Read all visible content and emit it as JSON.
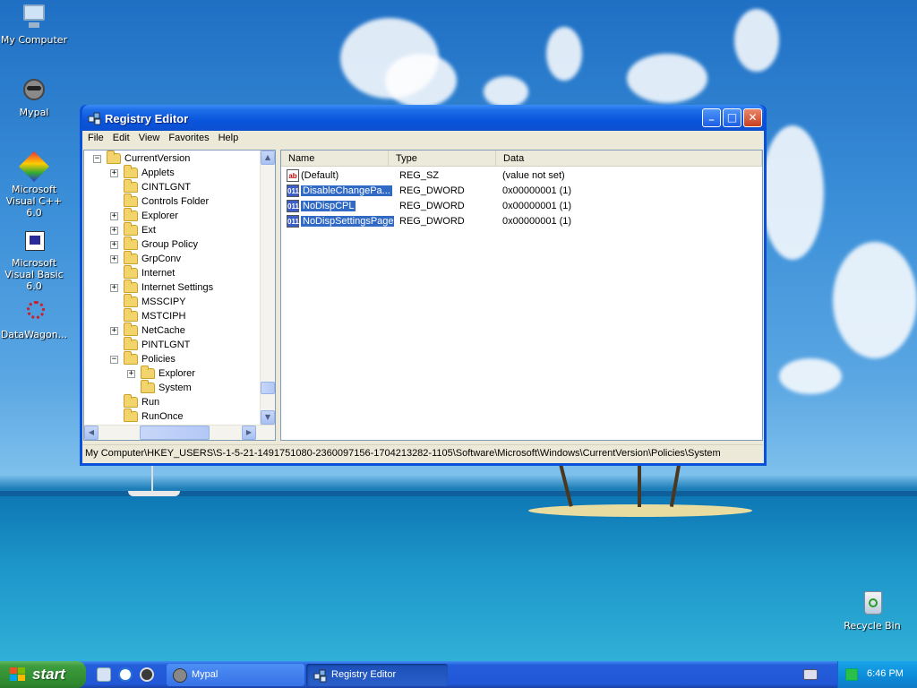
{
  "desktop": {
    "icons": [
      {
        "label": "My Computer",
        "icon": "my-computer-icon"
      },
      {
        "label": "Mypal",
        "icon": "mypal-raccoon-icon"
      },
      {
        "label": "Microsoft Visual C++ 6.0",
        "icon": "visual-cpp-icon"
      },
      {
        "label": "Microsoft Visual Basic 6.0",
        "icon": "visual-basic-icon"
      },
      {
        "label": "DataWagon...",
        "icon": "datawagon-icon"
      },
      {
        "label": "Recycle Bin",
        "icon": "recycle-bin-icon"
      }
    ]
  },
  "window": {
    "title": "Registry Editor",
    "buttons": {
      "minimize": "_",
      "maximize": "□",
      "close": "✕"
    },
    "menu": [
      "File",
      "Edit",
      "View",
      "Favorites",
      "Help"
    ],
    "tree": [
      {
        "label": "CurrentVersion",
        "level": 0,
        "expander": "−"
      },
      {
        "label": "Applets",
        "level": 1,
        "expander": "+"
      },
      {
        "label": "CINTLGNT",
        "level": 1,
        "expander": ""
      },
      {
        "label": "Controls Folder",
        "level": 1,
        "expander": ""
      },
      {
        "label": "Explorer",
        "level": 1,
        "expander": "+"
      },
      {
        "label": "Ext",
        "level": 1,
        "expander": "+"
      },
      {
        "label": "Group Policy",
        "level": 1,
        "expander": "+"
      },
      {
        "label": "GrpConv",
        "level": 1,
        "expander": "+"
      },
      {
        "label": "Internet",
        "level": 1,
        "expander": ""
      },
      {
        "label": "Internet Settings",
        "level": 1,
        "expander": "+"
      },
      {
        "label": "MSSCIPY",
        "level": 1,
        "expander": ""
      },
      {
        "label": "MSTCIPH",
        "level": 1,
        "expander": ""
      },
      {
        "label": "NetCache",
        "level": 1,
        "expander": "+"
      },
      {
        "label": "PINTLGNT",
        "level": 1,
        "expander": ""
      },
      {
        "label": "Policies",
        "level": 1,
        "expander": "−"
      },
      {
        "label": "Explorer",
        "level": 2,
        "expander": "+"
      },
      {
        "label": "System",
        "level": 2,
        "expander": ""
      },
      {
        "label": "Run",
        "level": 1,
        "expander": ""
      },
      {
        "label": "RunOnce",
        "level": 1,
        "expander": ""
      }
    ],
    "columns": [
      "Name",
      "Type",
      "Data"
    ],
    "values": [
      {
        "name": "(Default)",
        "type": "REG_SZ",
        "data": "(value not set)",
        "icon": "ab",
        "selected": false
      },
      {
        "name": "DisableChangePa...",
        "type": "REG_DWORD",
        "data": "0x00000001 (1)",
        "icon": "011",
        "selected": true
      },
      {
        "name": "NoDispCPL",
        "type": "REG_DWORD",
        "data": "0x00000001 (1)",
        "icon": "011",
        "selected": true
      },
      {
        "name": "NoDispSettingsPage",
        "type": "REG_DWORD",
        "data": "0x00000001 (1)",
        "icon": "011",
        "selected": true
      }
    ],
    "status": "My Computer\\HKEY_USERS\\S-1-5-21-1491751080-2360097156-1704213282-1105\\Software\\Microsoft\\Windows\\CurrentVersion\\Policies\\System"
  },
  "taskbar": {
    "start_label": "start",
    "tasks": [
      {
        "label": "Mypal",
        "active": false
      },
      {
        "label": "Registry Editor",
        "active": true
      }
    ],
    "clock": "6:46 PM"
  }
}
